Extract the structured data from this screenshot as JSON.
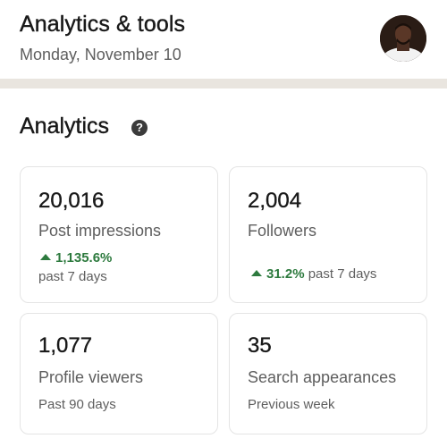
{
  "header": {
    "title": "Analytics & tools",
    "date": "Monday, November 10"
  },
  "section": {
    "title": "Analytics",
    "help_icon": "?"
  },
  "cards": [
    {
      "value": "20,016",
      "label": "Post impressions",
      "trend": "1,135.6%",
      "sub": "past 7 days"
    },
    {
      "value": "2,004",
      "label": "Followers",
      "trend": "31.2%",
      "sub": "past 7 days"
    },
    {
      "value": "1,077",
      "label": "Profile viewers",
      "sub": "Past 90 days"
    },
    {
      "value": "35",
      "label": "Search appearances",
      "sub": "Previous week"
    }
  ],
  "colors": {
    "trend_green": "#2d7a3e",
    "divider": "#e9e5df"
  }
}
